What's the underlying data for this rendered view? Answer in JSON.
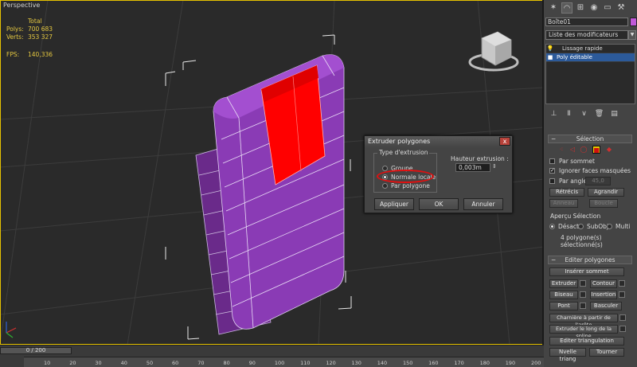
{
  "viewport": {
    "label": "Perspective",
    "stats": {
      "total_label": "Total",
      "polys_label": "Polys:",
      "polys_value": "700 683",
      "verts_label": "Verts:",
      "verts_value": "353 327",
      "fps_label": "FPS:",
      "fps_value": "140,336"
    },
    "viewcube_text": "FACE DROITE"
  },
  "dialog": {
    "title": "Extruder polygones",
    "close": "x",
    "group_label": "Type d'extrusion",
    "options": [
      "Groupe",
      "Normale locale",
      "Par polygone"
    ],
    "selected_option": "Normale locale",
    "height_label": "Hauteur extrusion :",
    "height_value": "0,003m",
    "buttons": {
      "apply": "Appliquer",
      "ok": "OK",
      "cancel": "Annuler"
    }
  },
  "panel": {
    "object_name": "Boîte01",
    "object_color": "#c058d8",
    "modifier_list": "Liste des modificateurs",
    "stack": [
      "Lissage rapide",
      "Poly éditable"
    ],
    "selection": {
      "title": "Sélection",
      "by_vertex": "Par sommet",
      "ignore_backfacing": "Ignorer faces masquées",
      "by_angle": "Par angle :",
      "angle_value": "45,0",
      "shrink": "Rétrécis",
      "grow": "Agrandir",
      "ring": "Anneau",
      "loop": "Boucle",
      "preview_label": "Aperçu Sélection",
      "preview_off": "Désact",
      "preview_subobj": "SubObj",
      "preview_multi": "Multi",
      "status": "4 polygone(s) sélectionné(s)"
    },
    "edit_polygons": {
      "title": "Editer polygones",
      "insert_vertex": "Insérer sommet",
      "extrude": "Extruder",
      "outline": "Contour",
      "bevel": "Biseau",
      "inset": "Insertion",
      "bridge": "Pont",
      "flip": "Basculer",
      "hinge": "Charnière à partir de l'arête",
      "extrude_spline": "Extruder le long de la spline",
      "edit_tri": "Editer triangulation",
      "retriangulate": "Nvelle triang",
      "turn": "Tourner"
    }
  },
  "timeline": {
    "position": "0 / 200",
    "ticks": [
      "10",
      "20",
      "30",
      "40",
      "50",
      "60",
      "70",
      "80",
      "90",
      "100",
      "110",
      "120",
      "130",
      "140",
      "150",
      "160",
      "170",
      "180",
      "190",
      "200"
    ]
  }
}
